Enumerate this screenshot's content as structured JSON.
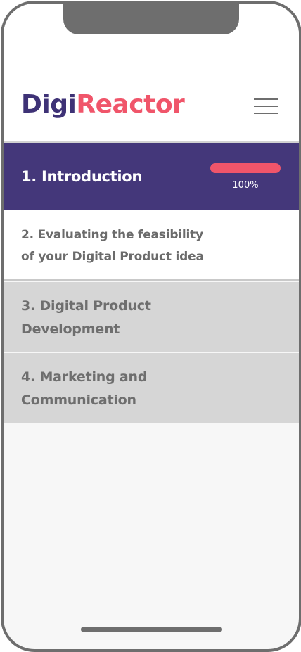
{
  "app": {
    "logo_part1": "Digi",
    "logo_part2": "Reactor"
  },
  "header": {
    "menu_icon": "hamburger-menu-icon"
  },
  "modules": [
    {
      "title": "1. Introduction",
      "progress_label": "100%",
      "progress_fraction": 1.0,
      "active": true
    },
    {
      "title_line1": "2. Evaluating the feasibility",
      "title_line2": "of your Digital Product idea"
    },
    {
      "title_line1": "3. Digital Product",
      "title_line2": "Development"
    },
    {
      "title_line1": "4. Marketing and",
      "title_line2": "Communication"
    }
  ],
  "colors": {
    "brand_primary": "#44377a",
    "brand_accent": "#f0556a",
    "locked_module_bg": "#d6d6d6"
  }
}
